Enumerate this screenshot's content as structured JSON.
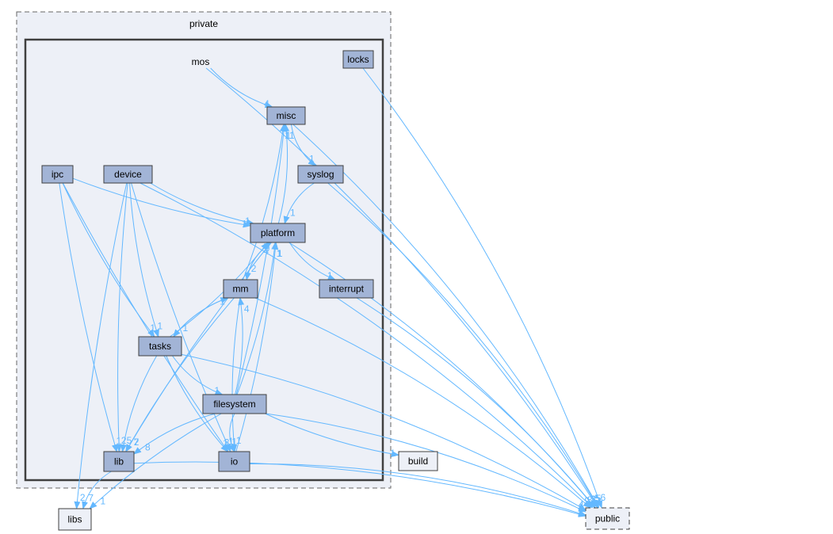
{
  "colors": {
    "edge": "#63b8ff",
    "node_fill": "#a2b4d6",
    "cluster_fill": "#edf0f7",
    "external_border": "#ff0000",
    "external_fill": "#edf0f7"
  },
  "clusters": {
    "private": "private",
    "mos": "mos"
  },
  "nodes": {
    "locks": "locks",
    "misc": "misc",
    "syslog": "syslog",
    "ipc": "ipc",
    "device": "device",
    "platform": "platform",
    "interrupt": "interrupt",
    "mm": "mm",
    "tasks": "tasks",
    "filesystem": "filesystem",
    "lib": "lib",
    "io": "io",
    "build": "build",
    "libs": "libs",
    "public": "public"
  },
  "edges": [
    {
      "from": "mos",
      "to": "misc",
      "count": "4"
    },
    {
      "from": "locks",
      "to": "public",
      "count": "6"
    },
    {
      "from": "mos",
      "to": "public",
      "count": "5"
    },
    {
      "from": "misc",
      "to": "public",
      "count": "5"
    },
    {
      "from": "syslog",
      "to": "public",
      "count": "5"
    },
    {
      "from": "device",
      "to": "public",
      "count": "3"
    },
    {
      "from": "platform",
      "to": "public",
      "count": "2"
    },
    {
      "from": "interrupt",
      "to": "public",
      "count": "3"
    },
    {
      "from": "mm",
      "to": "public",
      "count": "9"
    },
    {
      "from": "tasks",
      "to": "public",
      "count": "4"
    },
    {
      "from": "filesystem",
      "to": "public",
      "count": "1"
    },
    {
      "from": "io",
      "to": "public",
      "count": "1"
    },
    {
      "from": "lib",
      "to": "public",
      "count": "1"
    },
    {
      "from": "misc",
      "to": "syslog",
      "count": "1"
    },
    {
      "from": "syslog",
      "to": "platform",
      "count": "1"
    },
    {
      "from": "platform",
      "to": "misc",
      "count": "1"
    },
    {
      "from": "mm",
      "to": "misc",
      "count": "1"
    },
    {
      "from": "filesystem",
      "to": "misc",
      "count": "1"
    },
    {
      "from": "ipc",
      "to": "platform",
      "count": "1"
    },
    {
      "from": "device",
      "to": "platform",
      "count": "1"
    },
    {
      "from": "ipc",
      "to": "tasks",
      "count": "1"
    },
    {
      "from": "device",
      "to": "tasks",
      "count": "1"
    },
    {
      "from": "ipc",
      "to": "lib",
      "count": "1"
    },
    {
      "from": "ipc",
      "to": "io",
      "count": "3"
    },
    {
      "from": "device",
      "to": "libs",
      "count": "2"
    },
    {
      "from": "device",
      "to": "lib",
      "count": "2"
    },
    {
      "from": "device",
      "to": "io",
      "count": "1"
    },
    {
      "from": "platform",
      "to": "interrupt",
      "count": "1"
    },
    {
      "from": "platform",
      "to": "mm",
      "count": "2"
    },
    {
      "from": "mm",
      "to": "platform",
      "count": "9"
    },
    {
      "from": "tasks",
      "to": "platform",
      "count": "4"
    },
    {
      "from": "filesystem",
      "to": "platform",
      "count": "1"
    },
    {
      "from": "io",
      "to": "platform",
      "count": "1"
    },
    {
      "from": "platform",
      "to": "lib",
      "count": "2"
    },
    {
      "from": "mm",
      "to": "tasks",
      "count": "1"
    },
    {
      "from": "tasks",
      "to": "mm",
      "count": "1"
    },
    {
      "from": "tasks",
      "to": "filesystem",
      "count": "1"
    },
    {
      "from": "tasks",
      "to": "lib",
      "count": "5"
    },
    {
      "from": "tasks",
      "to": "io",
      "count": "1"
    },
    {
      "from": "filesystem",
      "to": "mm",
      "count": "4"
    },
    {
      "from": "mm",
      "to": "lib",
      "count": "7"
    },
    {
      "from": "mm",
      "to": "io",
      "count": "1"
    },
    {
      "from": "filesystem",
      "to": "lib",
      "count": "8"
    },
    {
      "from": "filesystem",
      "to": "io",
      "count": "1"
    },
    {
      "from": "filesystem",
      "to": "libs",
      "count": "1"
    },
    {
      "from": "filesystem",
      "to": "build",
      "count": "1"
    },
    {
      "from": "lib",
      "to": "libs",
      "count": "7"
    }
  ]
}
